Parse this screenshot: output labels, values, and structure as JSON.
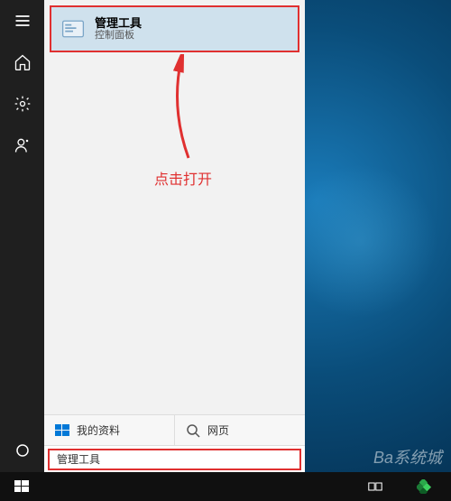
{
  "result": {
    "title": "管理工具",
    "subtitle": "控制面板"
  },
  "annotation": {
    "text": "点击打开"
  },
  "tabs": {
    "mydata": "我的资料",
    "web": "网页"
  },
  "search": {
    "value": "管理工具"
  },
  "watermark": "Ba系统城"
}
